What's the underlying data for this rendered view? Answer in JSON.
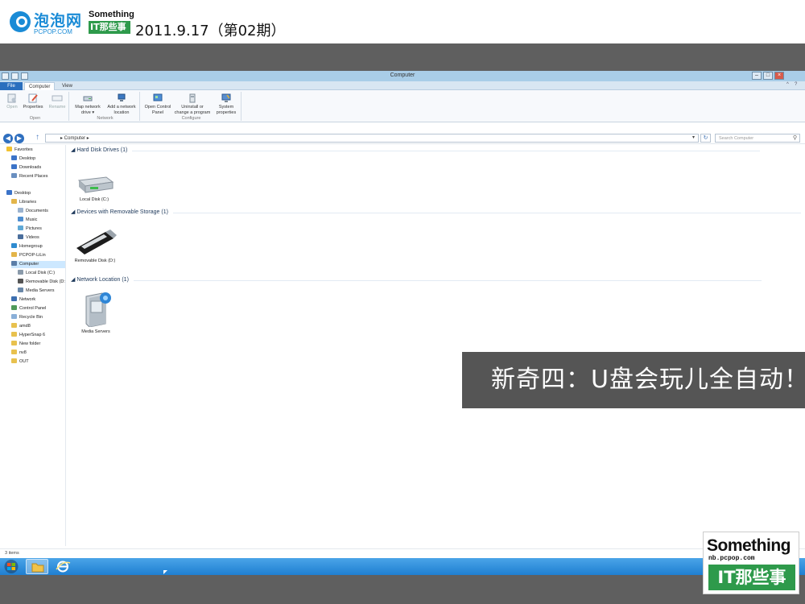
{
  "header": {
    "site_name_cn": "泡泡网",
    "site_name_en": "PCPOP.COM",
    "show_top": "Something",
    "show_bottom": "IT那些事",
    "issue": "2011.9.17（第02期）"
  },
  "window": {
    "title": "Computer",
    "minimize": "–",
    "maximize": "□",
    "close": "×"
  },
  "ribbon": {
    "tabs": [
      "File",
      "Computer",
      "View"
    ],
    "help": "?",
    "collapse": "^",
    "groups": {
      "open": {
        "label": "Open",
        "buttons": [
          "Open",
          "Properties",
          "Rename"
        ]
      },
      "network": {
        "label": "Network",
        "buttons": [
          "Map network drive ▾",
          "Add a network location"
        ]
      },
      "configure": {
        "label": "Configure",
        "buttons": [
          "Open Control Panel",
          "Uninstall or change a program",
          "System properties"
        ]
      }
    }
  },
  "address": {
    "back": "◀",
    "forward": "▶",
    "up": "↑",
    "path": "▸  Computer  ▸",
    "dropdown": "▾",
    "refresh": "↻",
    "search_placeholder": "Search Computer",
    "search_icon": "magnifier-icon"
  },
  "nav": [
    {
      "label": "Favorites",
      "color": "#f2c230"
    },
    {
      "label": "Desktop",
      "color": "#3b73c8"
    },
    {
      "label": "Downloads",
      "color": "#3b73c8"
    },
    {
      "label": "Recent Places",
      "color": "#6a8fc0"
    },
    {
      "label": "Desktop",
      "color": "#3b73c8"
    },
    {
      "label": "Libraries",
      "color": "#e3b54a"
    },
    {
      "label": "Documents",
      "color": "#9bb3cf"
    },
    {
      "label": "Music",
      "color": "#4f8fd0"
    },
    {
      "label": "Pictures",
      "color": "#5fa9d6"
    },
    {
      "label": "Videos",
      "color": "#4a6e9c"
    },
    {
      "label": "Homegroup",
      "color": "#2f8bd0"
    },
    {
      "label": "PCPOP-LiLin",
      "color": "#e3b54a"
    },
    {
      "label": "Computer",
      "color": "#5b7ea8"
    },
    {
      "label": "Local Disk (C:)",
      "color": "#8a9aaa"
    },
    {
      "label": "Removable Disk (D:)",
      "color": "#555555"
    },
    {
      "label": "Media Servers",
      "color": "#6a88a8"
    },
    {
      "label": "Network",
      "color": "#3d6fb0"
    },
    {
      "label": "Control Panel",
      "color": "#4f9a5a"
    },
    {
      "label": "Recycle Bin",
      "color": "#8ab0d8"
    },
    {
      "label": "amd8",
      "color": "#e8c14e"
    },
    {
      "label": "HyperSnap 6",
      "color": "#e8c14e"
    },
    {
      "label": "New folder",
      "color": "#e8c14e"
    },
    {
      "label": "nv8",
      "color": "#e8c14e"
    },
    {
      "label": "OUT",
      "color": "#e8c14e"
    }
  ],
  "groups": {
    "hdd": {
      "header": "Hard Disk Drives (1)",
      "item": "Local Disk (C:)"
    },
    "removable": {
      "header": "Devices with Removable Storage (1)",
      "item": "Removable Disk (D:)"
    },
    "network": {
      "header": "Network Location (1)",
      "item": "Media Servers"
    }
  },
  "status": "3 items",
  "caption": "新奇四：U盘会玩儿全自动！",
  "logo_big": {
    "top": "Something",
    "sub": "nb.pcpop.com",
    "bottom": "IT那些事"
  },
  "colors": {
    "accent": "#2a6fbe",
    "brand_blue": "#1a8bd6",
    "brand_green": "#2e9a4b",
    "taskbar": "#1f7fd1",
    "caption_bg": "#555555"
  }
}
